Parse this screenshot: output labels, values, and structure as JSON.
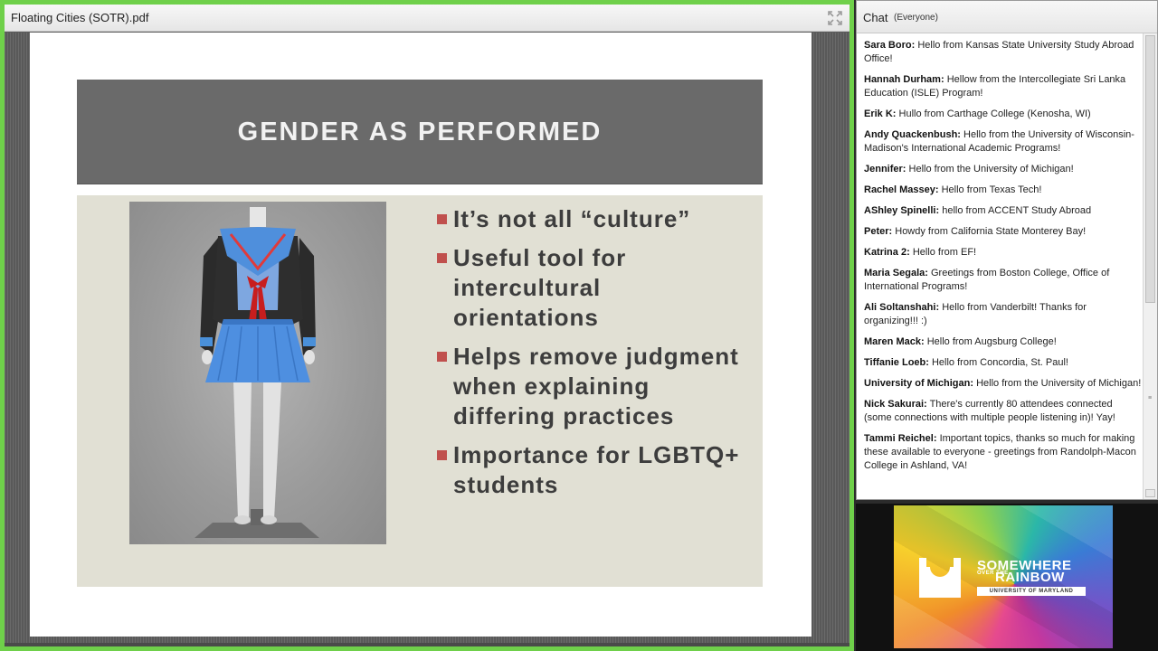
{
  "share": {
    "title": "Floating Cities (SOTR).pdf",
    "fullscreen_icon": "fullscreen-icon",
    "slide": {
      "title": "GENDER AS PERFORMED",
      "bullets": [
        "It’s not all “culture”",
        "Useful tool for intercultural orientations",
        "Helps remove judgment when explaining differing practices",
        "Importance for LGBTQ+ students"
      ]
    }
  },
  "chat": {
    "title": "Chat",
    "scope": "(Everyone)",
    "messages": [
      {
        "author": "Sara Boro:",
        "text": "Hello from Kansas State University Study Abroad Office!"
      },
      {
        "author": "Hannah Durham:",
        "text": "Hellow from the Intercollegiate Sri Lanka Education (ISLE) Program!"
      },
      {
        "author": "Erik K:",
        "text": "Hullo from Carthage College (Kenosha, WI)"
      },
      {
        "author": "Andy Quackenbush:",
        "text": "Hello from the University of Wisconsin-Madison's International Academic Programs!"
      },
      {
        "author": "Jennifer:",
        "text": "Hello from the University of Michigan!"
      },
      {
        "author": "Rachel Massey:",
        "text": "Hello from Texas Tech!"
      },
      {
        "author": "AShley Spinelli:",
        "text": "hello from ACCENT Study Abroad"
      },
      {
        "author": "Peter:",
        "text": "Howdy from California State Monterey Bay!"
      },
      {
        "author": "Katrina 2:",
        "text": "Hello from EF!"
      },
      {
        "author": "Maria Segala:",
        "text": "Greetings from Boston College, Office of International Programs!"
      },
      {
        "author": "Ali Soltanshahi:",
        "text": "Hello from Vanderbilt!  Thanks for organizing!!! :)"
      },
      {
        "author": "Maren Mack:",
        "text": "Hello from Augsburg College!"
      },
      {
        "author": "Tiffanie Loeb:",
        "text": "Hello from Concordia, St. Paul!"
      },
      {
        "author": "University of Michigan:",
        "text": "Hello from the University of Michigan!"
      },
      {
        "author": "Nick Sakurai:",
        "text": "There's currently 80 attendees connected (some connections with multiple people listening in)! Yay!"
      },
      {
        "author": "Tammi Reichel:",
        "text": "Important topics, thanks so much for making these available to everyone - greetings from Randolph-Macon College in Ashland, VA!"
      }
    ]
  },
  "camera": {
    "logo": {
      "line1": "SOMEWHERE",
      "line2": "OVER THE",
      "line3": "RAINBOW",
      "line4": "UNIVERSITY OF MARYLAND"
    }
  },
  "colors": {
    "pod_border": "#6fd04a",
    "bullet_marker": "#c0504d",
    "title_band": "#6a6a6a"
  }
}
